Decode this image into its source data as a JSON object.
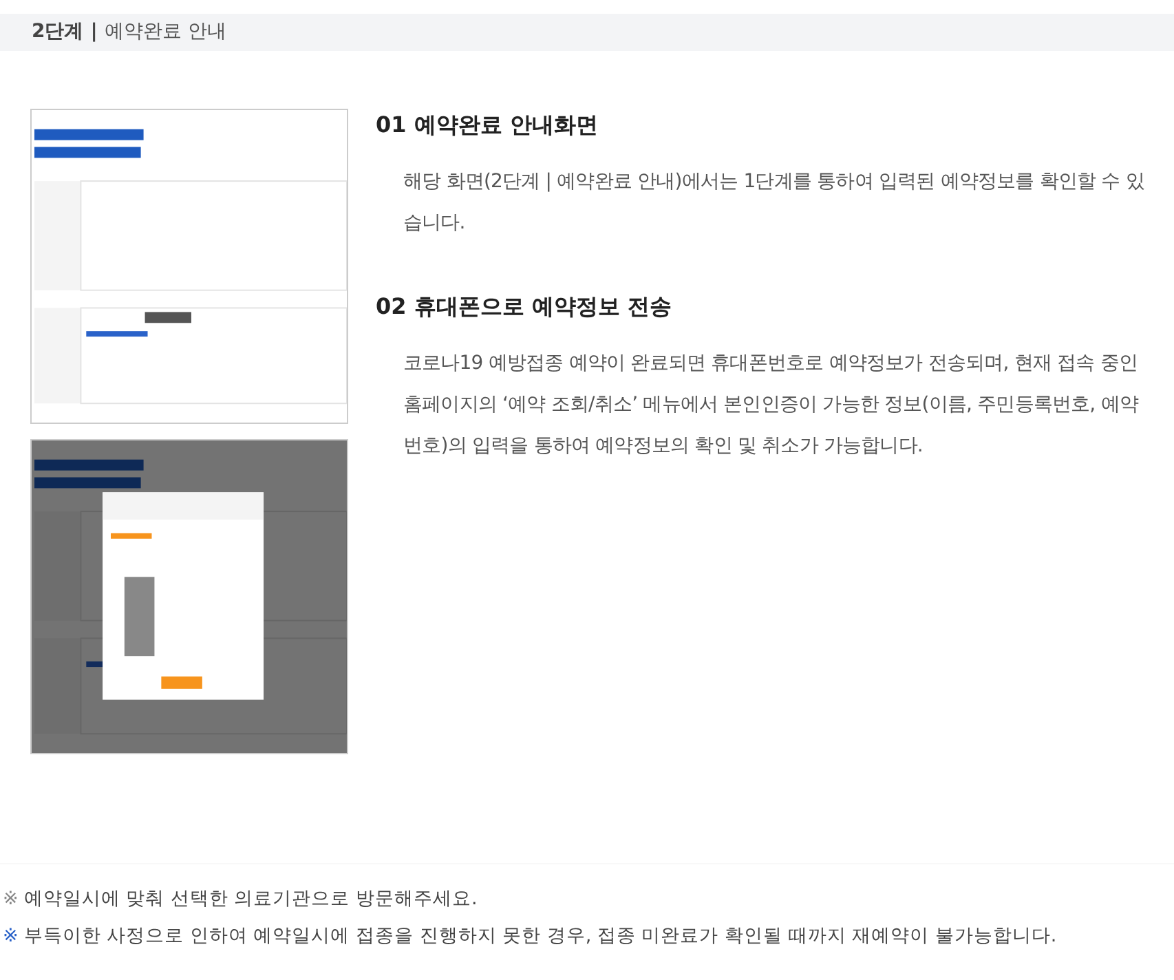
{
  "header": {
    "step": "2단계",
    "separator": "|",
    "title": "예약완료 안내"
  },
  "thumbnails": [
    {
      "kind": "picture",
      "overlay": false
    },
    {
      "kind": "picture",
      "overlay": true
    }
  ],
  "sections": [
    {
      "heading": "01 예약완료 안내화면",
      "body": "해당 화면(2단계 | 예약완료 안내)에서는 1단계를 통하여 입력된 예약정보를 확인할 수 있습니다."
    },
    {
      "heading": "02 휴대폰으로 예약정보 전송",
      "body": "코로나19 예방접종 예약이 완료되면 휴대폰번호로 예약정보가 전송되며, 현재 접속 중인 홈페이지의 ‘예약 조회/취소’ 메뉴에서 본인인증이 가능한 정보(이름, 주민등록번호, 예약번호)의 입력을 통하여 예약정보의 확인 및 취소가 가능합니다."
    }
  ],
  "notes": [
    {
      "mark": "※",
      "color": "#888888",
      "text": "예약일시에 맞춰 선택한 의료기관으로 방문해주세요."
    },
    {
      "mark": "※",
      "color": "#2a62c9",
      "text": "부득이한 사정으로 인하여 예약일시에 접종을 진행하지 못한 경우, 접종 미완료가 확인될 때까지 재예약이 불가능합니다."
    }
  ]
}
